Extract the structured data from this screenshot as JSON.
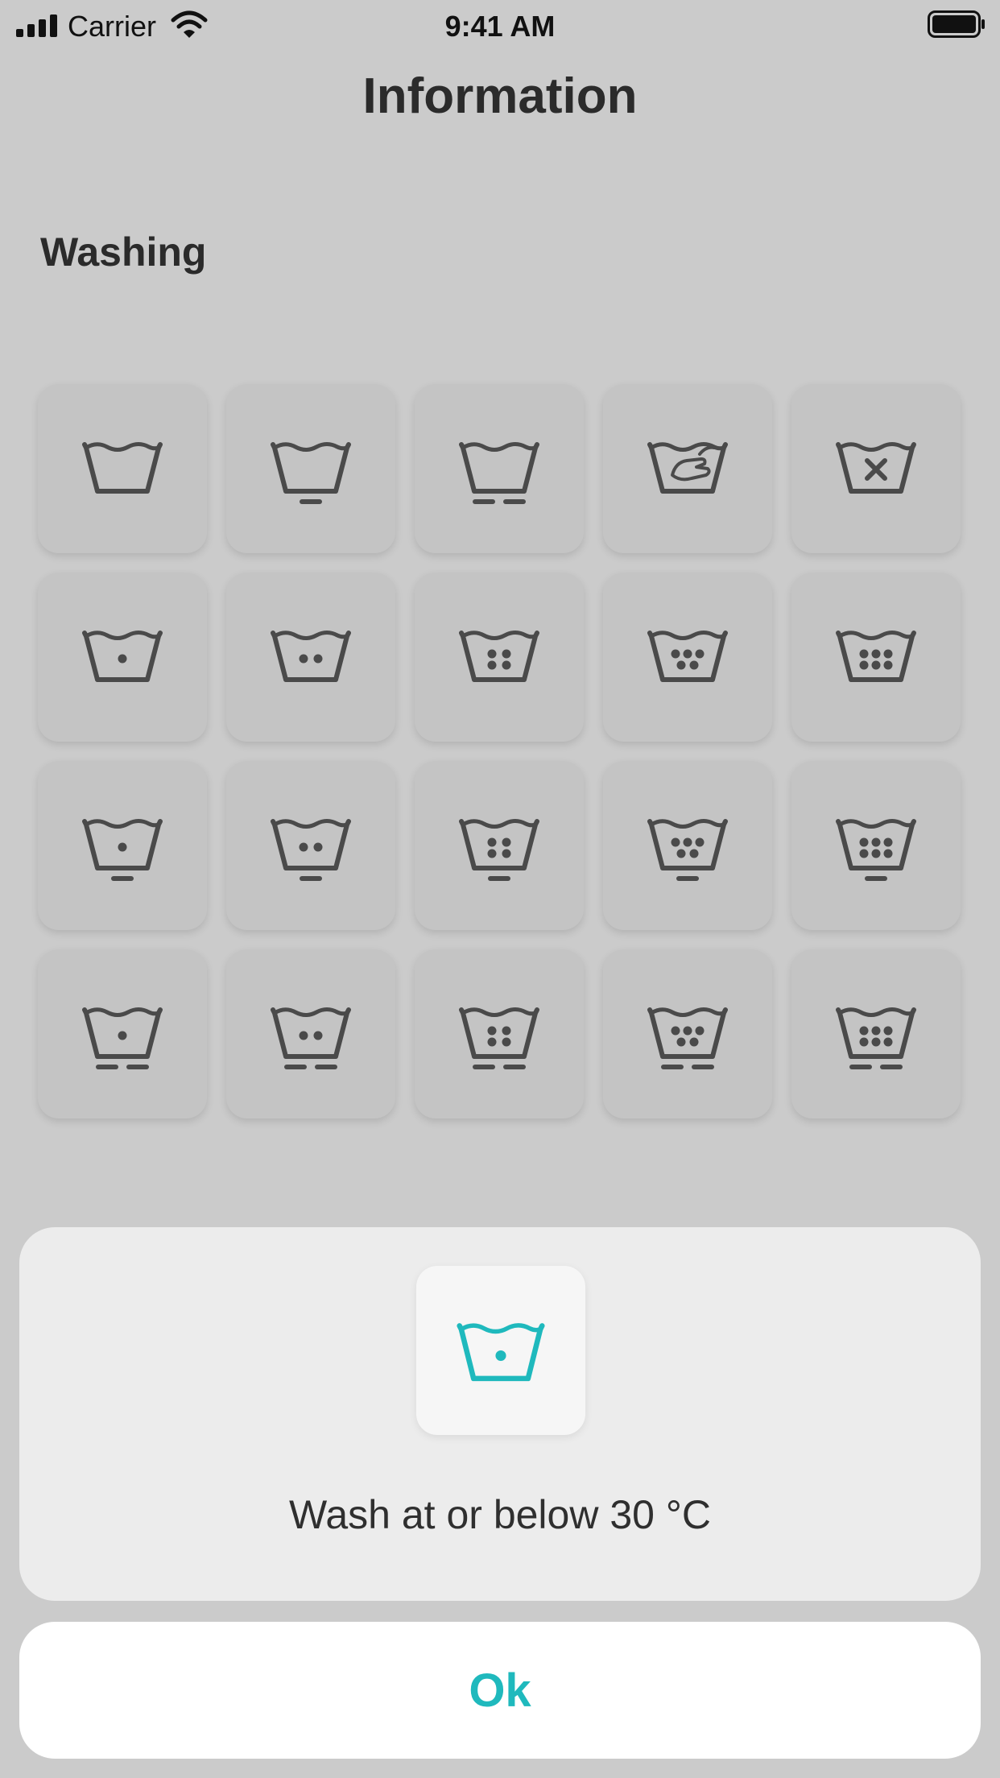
{
  "status_bar": {
    "carrier": "Carrier",
    "time": "9:41 AM"
  },
  "header": {
    "title": "Information"
  },
  "section": {
    "label": "Washing"
  },
  "icons": {
    "rows": [
      [
        "washtub-icon",
        "washtub-gentle-icon",
        "washtub-very-gentle-icon",
        "hand-wash-icon",
        "do-not-wash-icon"
      ],
      [
        "wash-30-icon",
        "wash-40-icon",
        "wash-50-icon",
        "wash-60-icon",
        "wash-95-icon"
      ],
      [
        "wash-30-gentle-icon",
        "wash-40-gentle-icon",
        "wash-50-gentle-icon",
        "wash-60-gentle-icon",
        "wash-95-gentle-icon"
      ],
      [
        "wash-30-very-gentle-icon",
        "wash-40-very-gentle-icon",
        "wash-50-very-gentle-icon",
        "wash-60-very-gentle-icon",
        "wash-95-very-gentle-icon"
      ]
    ]
  },
  "dialog": {
    "icon": "wash-30-icon",
    "text": "Wash at or below 30 °C",
    "accent_color": "#1fb9bd"
  },
  "ok_button": {
    "label": "Ok"
  },
  "colors": {
    "background": "#cbcbcb",
    "tile": "#c4c4c4",
    "icon": "#4a4a4a",
    "accent": "#1fb9bd"
  }
}
